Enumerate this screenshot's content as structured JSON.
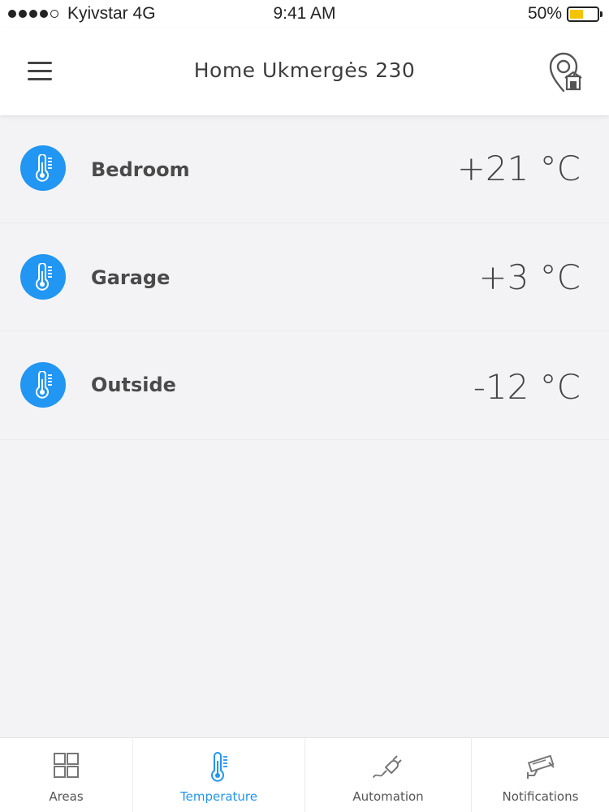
{
  "status_bar": {
    "carrier": "Kyivstar 4G",
    "time": "9:41 AM",
    "battery_percent": "50%",
    "battery_level": 0.5,
    "signal_bars_filled": 4,
    "signal_bars_total": 5
  },
  "header": {
    "title": "Home Ukmergės 230",
    "menu_icon": "hamburger-menu-icon",
    "location_icon": "location-pin-building-icon"
  },
  "sensors": [
    {
      "name": "Bedroom",
      "value": "+21 °C",
      "icon": "thermometer-icon"
    },
    {
      "name": "Garage",
      "value": "+3 °C",
      "icon": "thermometer-icon"
    },
    {
      "name": "Outside",
      "value": "-12 °C",
      "icon": "thermometer-icon"
    }
  ],
  "tabs": [
    {
      "label": "Areas",
      "icon": "grid-icon",
      "active": false
    },
    {
      "label": "Temperature",
      "icon": "thermometer-icon",
      "active": true
    },
    {
      "label": "Automation",
      "icon": "plug-icon",
      "active": false
    },
    {
      "label": "Notifications",
      "icon": "security-camera-icon",
      "active": false
    }
  ],
  "colors": {
    "accent": "#2196f3",
    "battery_fill": "#f5c400",
    "background": "#f3f3f5"
  }
}
